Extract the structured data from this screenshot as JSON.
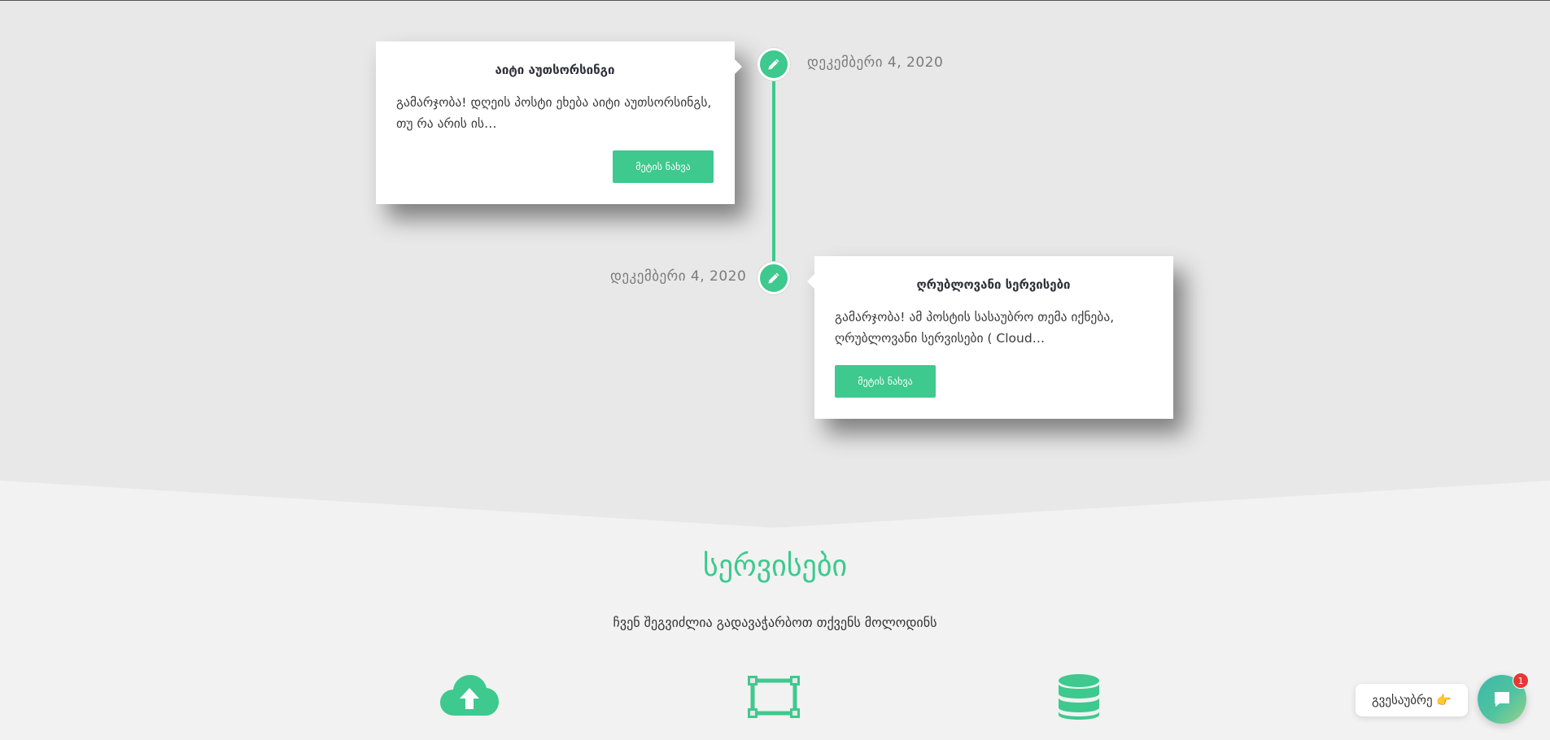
{
  "timeline": {
    "posts": [
      {
        "title": "აიტი აუთსორსინგი",
        "excerpt": "გამარჯობა! დღეის პოსტი ეხება აიტი აუთსორსინგს, თუ რა არის ის…",
        "button_label": "მეტის ნახვა",
        "date": "დეკემბერი 4, 2020",
        "icon": "pencil-icon"
      },
      {
        "title": "ღრუბლოვანი სერვისები",
        "excerpt": "გამარჯობა! ამ პოსტის სასაუბრო თემა იქნება, ღრუბლოვანი სერვისები ( Cloud…",
        "button_label": "მეტის ნახვა",
        "date": "დეკემბერი 4, 2020",
        "icon": "pencil-icon"
      }
    ],
    "accent_color": "#3ec98e"
  },
  "services": {
    "title": "სერვისები",
    "subtitle": "ჩვენ შეგვიძლია გადავაჭარბოთ თქვენს მოლოდინს",
    "icons": [
      "cloud-upload-icon",
      "vector-square-icon",
      "database-icon"
    ]
  },
  "chat": {
    "prompt": "გვესაუბრე 👉",
    "badge_count": "1",
    "icon": "chat-bubble-icon"
  }
}
